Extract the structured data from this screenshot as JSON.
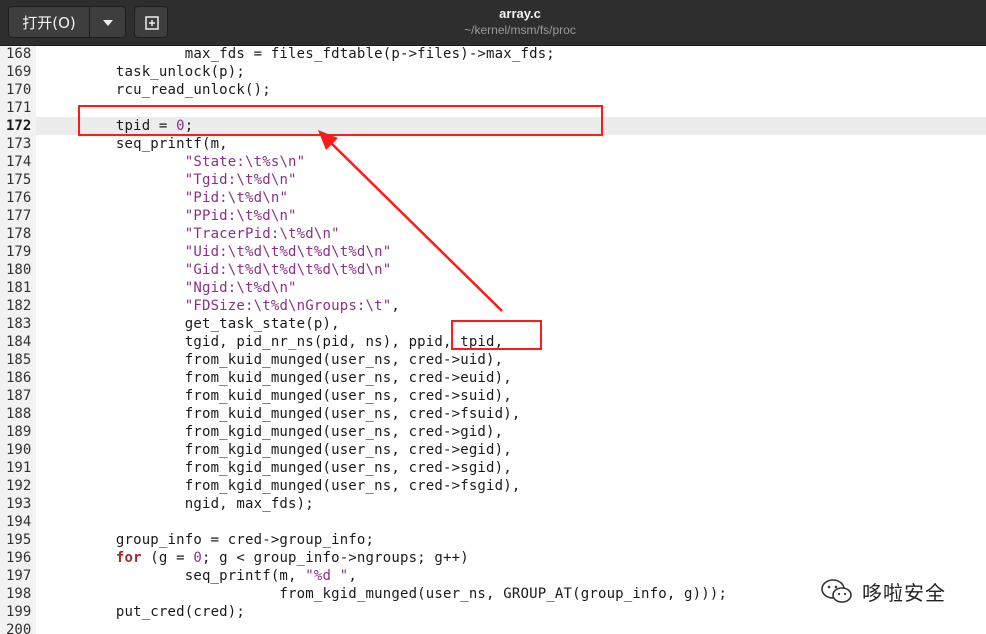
{
  "toolbar": {
    "open_label": "打开(O)",
    "open_menu_icon": "chevron-down-icon",
    "new_tab_icon": "new-tab-icon"
  },
  "window": {
    "title": "array.c",
    "subtitle": "~/kernel/msm/fs/proc"
  },
  "editor": {
    "current_line": 172,
    "lines": [
      {
        "n": "168",
        "t": "                max_fds = files_fdtable(p->files)->max_fds;"
      },
      {
        "n": "169",
        "t": "        task_unlock(p);"
      },
      {
        "n": "170",
        "t": "        rcu_read_unlock();"
      },
      {
        "n": "171",
        "t": ""
      },
      {
        "n": "172",
        "t": "        tpid = 0;"
      },
      {
        "n": "173",
        "t": "        seq_printf(m,"
      },
      {
        "n": "174",
        "t": "                \"State:\\t%s\\n\""
      },
      {
        "n": "175",
        "t": "                \"Tgid:\\t%d\\n\""
      },
      {
        "n": "176",
        "t": "                \"Pid:\\t%d\\n\""
      },
      {
        "n": "177",
        "t": "                \"PPid:\\t%d\\n\""
      },
      {
        "n": "178",
        "t": "                \"TracerPid:\\t%d\\n\""
      },
      {
        "n": "179",
        "t": "                \"Uid:\\t%d\\t%d\\t%d\\t%d\\n\""
      },
      {
        "n": "180",
        "t": "                \"Gid:\\t%d\\t%d\\t%d\\t%d\\n\""
      },
      {
        "n": "181",
        "t": "                \"Ngid:\\t%d\\n\""
      },
      {
        "n": "182",
        "t": "                \"FDSize:\\t%d\\nGroups:\\t\","
      },
      {
        "n": "183",
        "t": "                get_task_state(p),"
      },
      {
        "n": "184",
        "t": "                tgid, pid_nr_ns(pid, ns), ppid, tpid,"
      },
      {
        "n": "185",
        "t": "                from_kuid_munged(user_ns, cred->uid),"
      },
      {
        "n": "186",
        "t": "                from_kuid_munged(user_ns, cred->euid),"
      },
      {
        "n": "187",
        "t": "                from_kuid_munged(user_ns, cred->suid),"
      },
      {
        "n": "188",
        "t": "                from_kuid_munged(user_ns, cred->fsuid),"
      },
      {
        "n": "189",
        "t": "                from_kgid_munged(user_ns, cred->gid),"
      },
      {
        "n": "190",
        "t": "                from_kgid_munged(user_ns, cred->egid),"
      },
      {
        "n": "191",
        "t": "                from_kgid_munged(user_ns, cred->sgid),"
      },
      {
        "n": "192",
        "t": "                from_kgid_munged(user_ns, cred->fsgid),"
      },
      {
        "n": "193",
        "t": "                ngid, max_fds);"
      },
      {
        "n": "194",
        "t": ""
      },
      {
        "n": "195",
        "t": "        group_info = cred->group_info;"
      },
      {
        "n": "196",
        "t": "        for (g = 0; g < group_info->ngroups; g++)"
      },
      {
        "n": "197",
        "t": "                seq_printf(m, \"%d \","
      },
      {
        "n": "198",
        "t": "                           from_kgid_munged(user_ns, GROUP_AT(group_info, g)));"
      },
      {
        "n": "199",
        "t": "        put_cred(cred);"
      },
      {
        "n": "200",
        "t": ""
      }
    ]
  },
  "annotation": {
    "color": "#ff1a1a"
  },
  "watermark": {
    "icon": "wechat-icon",
    "text": "哆啦安全"
  }
}
